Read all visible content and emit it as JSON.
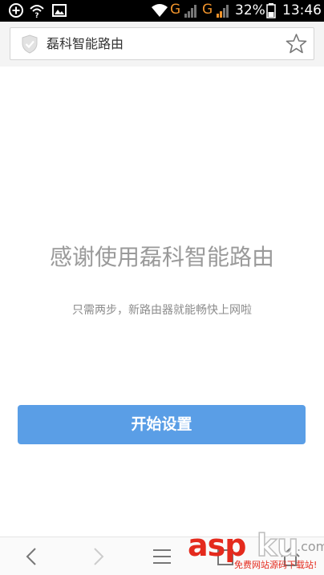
{
  "status_bar": {
    "left_icons": [
      "add-circle-icon",
      "wifi-question-icon",
      "image-icon"
    ],
    "network_1": "G",
    "network_2": "G",
    "battery": "32%",
    "time": "13:46",
    "colors": {
      "network_g": "#f0932b",
      "signal_g": "#f0932b"
    }
  },
  "address_bar": {
    "title": "磊科智能路由",
    "left_icon": "shield-check-icon",
    "right_icon": "star-outline-icon"
  },
  "main": {
    "headline": "感谢使用磊科智能路由",
    "subline": "只需两步，新路由器就能畅快上网啦",
    "start_button_label": "开始设置",
    "button_color": "#5a9ee6"
  },
  "bottom_nav": {
    "icons": [
      "back-arrow-icon",
      "forward-arrow-icon",
      "menu-icon",
      "tabs-icon",
      "home-icon"
    ]
  },
  "watermark": {
    "brand_red": "asp",
    "brand_white": "ku",
    "domain": ".com",
    "tagline": "免费网站源码下载站!"
  }
}
